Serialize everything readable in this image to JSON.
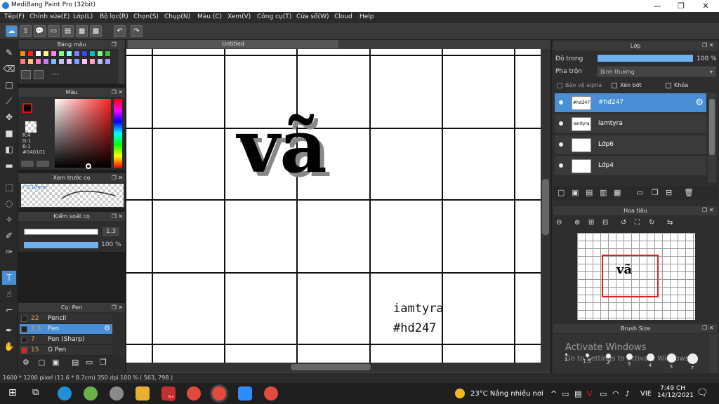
{
  "window": {
    "title": "MediBang Paint Pro (32bit)",
    "minimize": "—",
    "maximize": "❐",
    "close": "✕"
  },
  "menu": [
    "Tệp(F)",
    "Chỉnh sửa(E)",
    "Lớp(L)",
    "Bộ lọc(R)",
    "Chọn(S)",
    "Chụp(N)",
    "Màu (C)",
    "Xem(V)",
    "Công cụ(T)",
    "Cửa sổ(W)",
    "Cloud",
    "Help"
  ],
  "document_tab": "Untitled",
  "palette": {
    "title": "Bảng màu",
    "footer": "---",
    "colors": [
      "#ff8c00",
      "#ff2020",
      "#ffffff",
      "#ffff80",
      "#ff80ff",
      "#80ff80",
      "#80ffff",
      "#8080ff",
      "#4040ff",
      "#00c0c0",
      "#80ff80",
      "#40c040",
      "#ff8080",
      "#ffc080",
      "#ff80c0",
      "#c080ff",
      "#80c0ff",
      "#c0c0ff",
      "#e0c0ff",
      "#80a0ff",
      "#ffc0ff",
      "#ffa0c0",
      "#c0c0ff",
      "#a0a0ff"
    ]
  },
  "color_panel": {
    "title": "Màu",
    "r": "R:4",
    "g": "G:1",
    "b": "B:1",
    "hex": "#040101",
    "primary": "#e01010",
    "secondary": "#040101"
  },
  "preview_panel": {
    "title": "Xem trước cọ",
    "size": "* 0.10mm"
  },
  "brush_control": {
    "title": "Kiểm soát cọ",
    "size_value": "1.3",
    "opacity_value": "100 %"
  },
  "brush_list": {
    "title": "Cọ: Pen",
    "items": [
      {
        "size": "22",
        "name": "Pencil",
        "color": "#222222",
        "selected": false
      },
      {
        "size": "1.3",
        "name": "Pen",
        "color": "#222222",
        "selected": true
      },
      {
        "size": "7",
        "name": "Pen (Sharp)",
        "color": "#222222",
        "selected": false
      },
      {
        "size": "15",
        "name": "G Pen",
        "color": "#e02020",
        "selected": false
      }
    ]
  },
  "layers_panel": {
    "title": "Lớp",
    "opacity_label": "Độ trong",
    "opacity_value": "100 %",
    "opacity_fill": 1.0,
    "blend_label": "Pha trộn",
    "blend_value": "Bình thường",
    "protect_alpha": "Bảo vệ alpha",
    "clipping": "Xén bớt",
    "lock": "Khóa",
    "layers": [
      {
        "name": "#hd247",
        "selected": true,
        "thumb": "#hd247"
      },
      {
        "name": "iamtyra",
        "selected": false,
        "thumb": "iamtyra"
      },
      {
        "name": "Lớp6",
        "selected": false,
        "thumb": ""
      },
      {
        "name": "Lớp4",
        "selected": false,
        "thumb": ""
      }
    ]
  },
  "navigator": {
    "title": "Hoa tiêu",
    "preview_text": "vã"
  },
  "brush_size": {
    "title": "Brush Size",
    "sizes": [
      "1",
      "1.5",
      "2",
      "3",
      "4",
      "5",
      "7"
    ]
  },
  "canvas": {
    "main_text": "vã",
    "signature_name": "iamtyra",
    "signature_tag": "#hd247"
  },
  "watermark": {
    "line1": "Activate Windows",
    "line2": "Go to Settings to activate Windows."
  },
  "status": {
    "text": "1600 * 1200 pixel  (11.6 * 8.7cm)  350 dpi  100 %  ( 563, 798 )"
  },
  "taskbar": {
    "weather": "23°C  Nắng nhiều nơi",
    "lang": "VIE",
    "time": "7:49 CH",
    "date": "14/12/2021",
    "badge": "5+"
  }
}
